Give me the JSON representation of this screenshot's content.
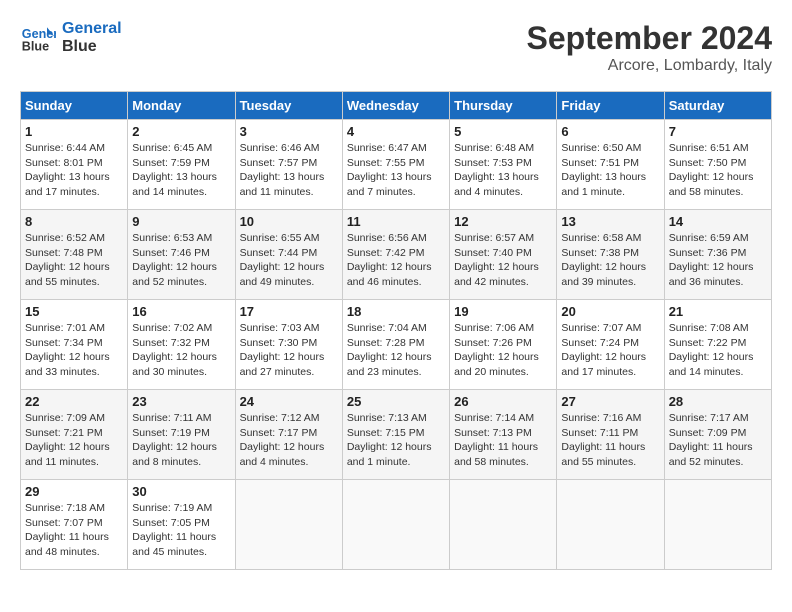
{
  "logo": {
    "line1": "General",
    "line2": "Blue"
  },
  "title": "September 2024",
  "subtitle": "Arcore, Lombardy, Italy",
  "days_header": [
    "Sunday",
    "Monday",
    "Tuesday",
    "Wednesday",
    "Thursday",
    "Friday",
    "Saturday"
  ],
  "weeks": [
    [
      {
        "num": "1",
        "info": "Sunrise: 6:44 AM\nSunset: 8:01 PM\nDaylight: 13 hours\nand 17 minutes."
      },
      {
        "num": "2",
        "info": "Sunrise: 6:45 AM\nSunset: 7:59 PM\nDaylight: 13 hours\nand 14 minutes."
      },
      {
        "num": "3",
        "info": "Sunrise: 6:46 AM\nSunset: 7:57 PM\nDaylight: 13 hours\nand 11 minutes."
      },
      {
        "num": "4",
        "info": "Sunrise: 6:47 AM\nSunset: 7:55 PM\nDaylight: 13 hours\nand 7 minutes."
      },
      {
        "num": "5",
        "info": "Sunrise: 6:48 AM\nSunset: 7:53 PM\nDaylight: 13 hours\nand 4 minutes."
      },
      {
        "num": "6",
        "info": "Sunrise: 6:50 AM\nSunset: 7:51 PM\nDaylight: 13 hours\nand 1 minute."
      },
      {
        "num": "7",
        "info": "Sunrise: 6:51 AM\nSunset: 7:50 PM\nDaylight: 12 hours\nand 58 minutes."
      }
    ],
    [
      {
        "num": "8",
        "info": "Sunrise: 6:52 AM\nSunset: 7:48 PM\nDaylight: 12 hours\nand 55 minutes."
      },
      {
        "num": "9",
        "info": "Sunrise: 6:53 AM\nSunset: 7:46 PM\nDaylight: 12 hours\nand 52 minutes."
      },
      {
        "num": "10",
        "info": "Sunrise: 6:55 AM\nSunset: 7:44 PM\nDaylight: 12 hours\nand 49 minutes."
      },
      {
        "num": "11",
        "info": "Sunrise: 6:56 AM\nSunset: 7:42 PM\nDaylight: 12 hours\nand 46 minutes."
      },
      {
        "num": "12",
        "info": "Sunrise: 6:57 AM\nSunset: 7:40 PM\nDaylight: 12 hours\nand 42 minutes."
      },
      {
        "num": "13",
        "info": "Sunrise: 6:58 AM\nSunset: 7:38 PM\nDaylight: 12 hours\nand 39 minutes."
      },
      {
        "num": "14",
        "info": "Sunrise: 6:59 AM\nSunset: 7:36 PM\nDaylight: 12 hours\nand 36 minutes."
      }
    ],
    [
      {
        "num": "15",
        "info": "Sunrise: 7:01 AM\nSunset: 7:34 PM\nDaylight: 12 hours\nand 33 minutes."
      },
      {
        "num": "16",
        "info": "Sunrise: 7:02 AM\nSunset: 7:32 PM\nDaylight: 12 hours\nand 30 minutes."
      },
      {
        "num": "17",
        "info": "Sunrise: 7:03 AM\nSunset: 7:30 PM\nDaylight: 12 hours\nand 27 minutes."
      },
      {
        "num": "18",
        "info": "Sunrise: 7:04 AM\nSunset: 7:28 PM\nDaylight: 12 hours\nand 23 minutes."
      },
      {
        "num": "19",
        "info": "Sunrise: 7:06 AM\nSunset: 7:26 PM\nDaylight: 12 hours\nand 20 minutes."
      },
      {
        "num": "20",
        "info": "Sunrise: 7:07 AM\nSunset: 7:24 PM\nDaylight: 12 hours\nand 17 minutes."
      },
      {
        "num": "21",
        "info": "Sunrise: 7:08 AM\nSunset: 7:22 PM\nDaylight: 12 hours\nand 14 minutes."
      }
    ],
    [
      {
        "num": "22",
        "info": "Sunrise: 7:09 AM\nSunset: 7:21 PM\nDaylight: 12 hours\nand 11 minutes."
      },
      {
        "num": "23",
        "info": "Sunrise: 7:11 AM\nSunset: 7:19 PM\nDaylight: 12 hours\nand 8 minutes."
      },
      {
        "num": "24",
        "info": "Sunrise: 7:12 AM\nSunset: 7:17 PM\nDaylight: 12 hours\nand 4 minutes."
      },
      {
        "num": "25",
        "info": "Sunrise: 7:13 AM\nSunset: 7:15 PM\nDaylight: 12 hours\nand 1 minute."
      },
      {
        "num": "26",
        "info": "Sunrise: 7:14 AM\nSunset: 7:13 PM\nDaylight: 11 hours\nand 58 minutes."
      },
      {
        "num": "27",
        "info": "Sunrise: 7:16 AM\nSunset: 7:11 PM\nDaylight: 11 hours\nand 55 minutes."
      },
      {
        "num": "28",
        "info": "Sunrise: 7:17 AM\nSunset: 7:09 PM\nDaylight: 11 hours\nand 52 minutes."
      }
    ],
    [
      {
        "num": "29",
        "info": "Sunrise: 7:18 AM\nSunset: 7:07 PM\nDaylight: 11 hours\nand 48 minutes."
      },
      {
        "num": "30",
        "info": "Sunrise: 7:19 AM\nSunset: 7:05 PM\nDaylight: 11 hours\nand 45 minutes."
      },
      {
        "num": "",
        "info": ""
      },
      {
        "num": "",
        "info": ""
      },
      {
        "num": "",
        "info": ""
      },
      {
        "num": "",
        "info": ""
      },
      {
        "num": "",
        "info": ""
      }
    ]
  ]
}
